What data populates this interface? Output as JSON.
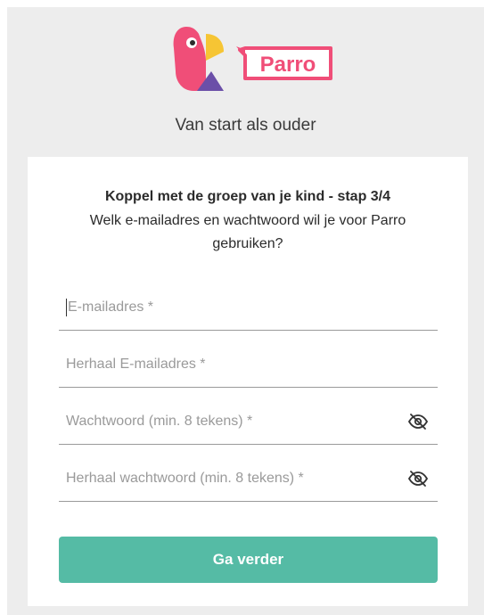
{
  "brand": {
    "name": "Parro",
    "logo_icon": "parrot-logo-icon",
    "color": "#f04e78"
  },
  "page": {
    "heading": "Van start als ouder"
  },
  "card": {
    "title": "Koppel met de groep van je kind - stap 3/4",
    "subtitle": "Welk e-mailadres en wachtwoord wil je voor Parro gebruiken?"
  },
  "form": {
    "email": {
      "placeholder": "E-mailadres *",
      "value": ""
    },
    "email_repeat": {
      "placeholder": "Herhaal E-mailadres *",
      "value": ""
    },
    "password": {
      "placeholder": "Wachtwoord (min. 8 tekens) *",
      "value": "",
      "toggle_icon": "eye-slash-icon"
    },
    "password_repeat": {
      "placeholder": "Herhaal wachtwoord (min. 8 tekens) *",
      "value": "",
      "toggle_icon": "eye-slash-icon"
    },
    "submit_label": "Ga verder"
  },
  "colors": {
    "background": "#ededed",
    "card": "#ffffff",
    "button": "#55bba5",
    "text": "#2b2b2b",
    "placeholder": "#9a9a9a"
  }
}
